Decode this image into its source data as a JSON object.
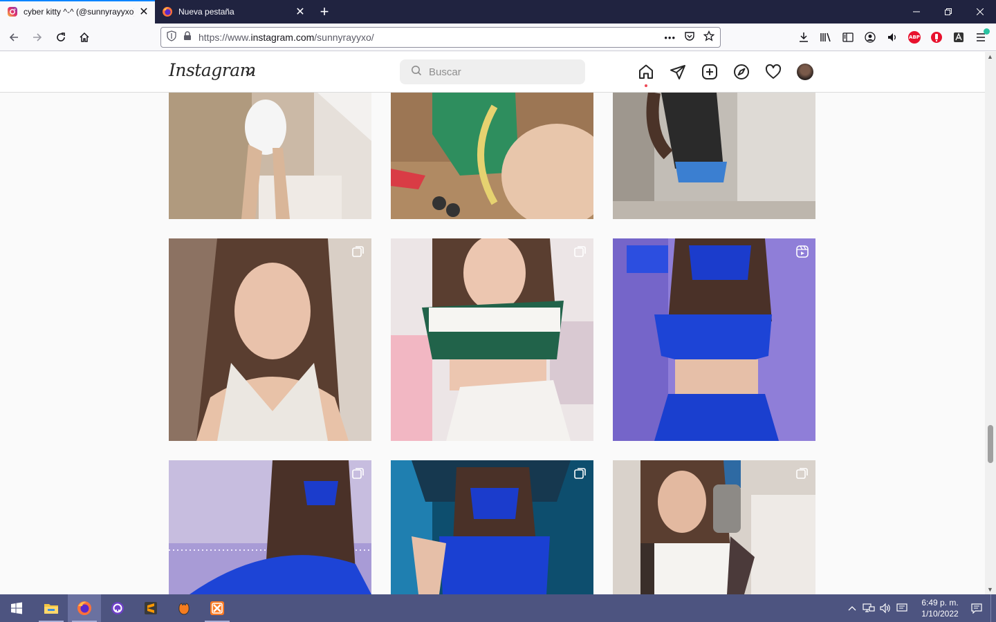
{
  "browser": {
    "tabs": [
      {
        "title": "cyber kitty ^-^ (@sunnyrayyxo) • Instagram",
        "active": true,
        "icon": "instagram-icon"
      },
      {
        "title": "Nueva pestaña",
        "active": false,
        "icon": "firefox-icon"
      }
    ],
    "new_tab_label": "+",
    "url": {
      "prefix": "https://www.",
      "domain": "instagram.com",
      "path": "/sunnyrayyxo/"
    },
    "more_label": "•••"
  },
  "instagram": {
    "logo_text": "Instagram",
    "search_placeholder": "Buscar",
    "nav": [
      "home-icon",
      "direct-icon",
      "new-post-icon",
      "explore-icon",
      "activity-icon",
      "profile-avatar"
    ]
  },
  "posts": [
    {
      "type": "partial",
      "badge": null,
      "palette": [
        "#cdb8a4",
        "#efe9e4",
        "#a38b6e"
      ]
    },
    {
      "type": "partial",
      "badge": null,
      "palette": [
        "#b98c62",
        "#2f8f5f",
        "#e7c3a8"
      ]
    },
    {
      "type": "partial",
      "badge": null,
      "palette": [
        "#b8b2aa",
        "#2a2a2a",
        "#d9d4cd"
      ]
    },
    {
      "type": "photo",
      "badge": "carousel",
      "palette": [
        "#8a7060",
        "#e8ddd2",
        "#5a4032"
      ]
    },
    {
      "type": "photo",
      "badge": "carousel",
      "palette": [
        "#e9e2e4",
        "#21634a",
        "#f4f1ee"
      ]
    },
    {
      "type": "photo",
      "badge": "reel",
      "palette": [
        "#8c7ad9",
        "#1a3ecf",
        "#b6a8f0"
      ]
    },
    {
      "type": "photo",
      "badge": "carousel",
      "palette": [
        "#a99bd8",
        "#1b3fc9",
        "#d8cfd8"
      ]
    },
    {
      "type": "photo",
      "badge": "carousel",
      "palette": [
        "#0d5a7e",
        "#1a3fcf",
        "#2f7ea8"
      ]
    },
    {
      "type": "photo",
      "badge": "carousel",
      "palette": [
        "#d7cfc8",
        "#f2f0ee",
        "#3a2e2a"
      ]
    }
  ],
  "taskbar": {
    "apps": [
      "windows-start-icon",
      "file-explorer-icon",
      "firefox-icon",
      "github-desktop-icon",
      "sublime-text-icon",
      "xampp-icon",
      "xampp-control-icon"
    ],
    "time": "6:49 p. m.",
    "date": "1/10/2022"
  },
  "colors": {
    "tabstrip": "#202340",
    "taskbar": "#4d5480",
    "instagram_text": "#262626",
    "notification_dot": "#ed4956"
  }
}
